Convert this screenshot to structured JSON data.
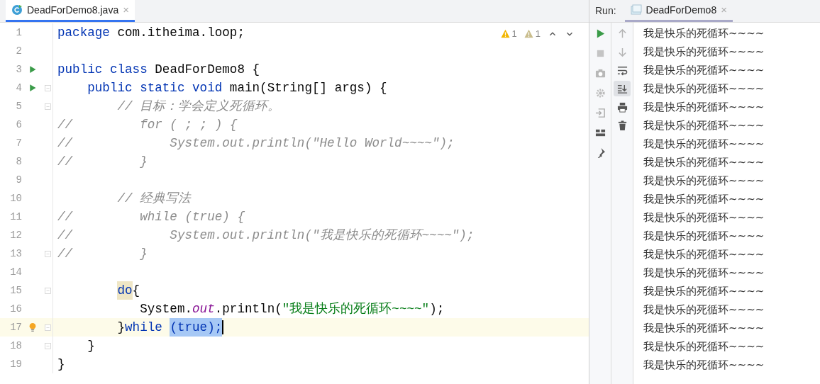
{
  "editor": {
    "tab": {
      "label": "DeadForDemo8.java",
      "close": "×",
      "selected": true
    },
    "inspections": [
      {
        "kind": "warning",
        "count": "1"
      },
      {
        "kind": "weak_warning",
        "count": "1"
      }
    ],
    "lines": [
      {
        "number": "1",
        "segments": [
          {
            "text": "package ",
            "kind": "keyword"
          },
          {
            "text": "com.itheima.loop;",
            "kind": "plain"
          }
        ]
      },
      {
        "number": "2"
      },
      {
        "number": "3",
        "run": true,
        "segments": [
          {
            "text": "public class ",
            "kind": "keyword"
          },
          {
            "text": "DeadForDemo8 {",
            "kind": "plain"
          }
        ]
      },
      {
        "number": "4",
        "run": true,
        "fold": true,
        "segments": [
          {
            "text": "    public static void ",
            "kind": "keyword"
          },
          {
            "text": "main(String[] args) {",
            "kind": "plain"
          }
        ]
      },
      {
        "number": "5",
        "fold": true,
        "segments": [
          {
            "text": "        // 目标：学会定义死循环。",
            "kind": "comment"
          }
        ]
      },
      {
        "number": "6",
        "segments": [
          {
            "text": "//         for ( ; ; ) {",
            "kind": "comment"
          }
        ]
      },
      {
        "number": "7",
        "segments": [
          {
            "text": "//             System.out.println(\"Hello World~~~~\");",
            "kind": "comment"
          }
        ]
      },
      {
        "number": "8",
        "segments": [
          {
            "text": "//         }",
            "kind": "comment"
          }
        ]
      },
      {
        "number": "9"
      },
      {
        "number": "10",
        "segments": [
          {
            "text": "        // 经典写法",
            "kind": "comment"
          }
        ]
      },
      {
        "number": "11",
        "segments": [
          {
            "text": "//         while (true) {",
            "kind": "comment"
          }
        ]
      },
      {
        "number": "12",
        "segments": [
          {
            "text": "//             System.out.println(\"我是快乐的死循环~~~~\");",
            "kind": "comment"
          }
        ]
      },
      {
        "number": "13",
        "fold": true,
        "segments": [
          {
            "text": "//         }",
            "kind": "comment"
          }
        ]
      },
      {
        "number": "14"
      },
      {
        "number": "15",
        "fold": true,
        "segments": [
          {
            "text": "        do",
            "kind": "matched_keyword"
          },
          {
            "text": "{",
            "kind": "plain"
          }
        ]
      },
      {
        "number": "16",
        "segments": [
          {
            "text": "           System.",
            "kind": "plain"
          },
          {
            "text": "out",
            "kind": "field"
          },
          {
            "text": ".println(",
            "kind": "plain"
          },
          {
            "text": "\"我是快乐的死循环~~~~\"",
            "kind": "string"
          },
          {
            "text": ");",
            "kind": "plain"
          }
        ]
      },
      {
        "number": "17",
        "current": true,
        "fold": true,
        "bulb": true,
        "segments": [
          {
            "text": "        }",
            "kind": "plain"
          },
          {
            "text": "while ",
            "kind": "keyword"
          },
          {
            "text": "(true);",
            "kind": "selection"
          }
        ]
      },
      {
        "number": "18",
        "fold": true,
        "segments": [
          {
            "text": "    }",
            "kind": "plain"
          }
        ]
      },
      {
        "number": "19",
        "segments": [
          {
            "text": "}",
            "kind": "plain"
          }
        ]
      }
    ]
  },
  "run_panel": {
    "label": "Run:",
    "tab": {
      "label": "DeadForDemo8",
      "close": "×",
      "selected": true
    },
    "toolbar_1": [
      {
        "kind": "rerun"
      },
      {
        "kind": "stop"
      },
      {
        "kind": "camera"
      },
      {
        "kind": "gear"
      },
      {
        "kind": "exit"
      },
      {
        "kind": "layout"
      },
      {
        "kind": "pin"
      }
    ],
    "toolbar_2": [
      {
        "kind": "up",
        "selected": false
      },
      {
        "kind": "down",
        "selected": false
      },
      {
        "kind": "wrap",
        "selected": false
      },
      {
        "kind": "scroll_end",
        "selected": true
      },
      {
        "kind": "print",
        "selected": false
      },
      {
        "kind": "trash",
        "selected": false
      }
    ],
    "output": [
      "我是快乐的死循环~~~~",
      "我是快乐的死循环~~~~",
      "我是快乐的死循环~~~~",
      "我是快乐的死循环~~~~",
      "我是快乐的死循环~~~~",
      "我是快乐的死循环~~~~",
      "我是快乐的死循环~~~~",
      "我是快乐的死循环~~~~",
      "我是快乐的死循环~~~~",
      "我是快乐的死循环~~~~",
      "我是快乐的死循环~~~~",
      "我是快乐的死循环~~~~",
      "我是快乐的死循环~~~~",
      "我是快乐的死循环~~~~",
      "我是快乐的死循环~~~~",
      "我是快乐的死循环~~~~",
      "我是快乐的死循环~~~~",
      "我是快乐的死循环~~~~",
      "我是快乐的死循环~~~~"
    ]
  }
}
